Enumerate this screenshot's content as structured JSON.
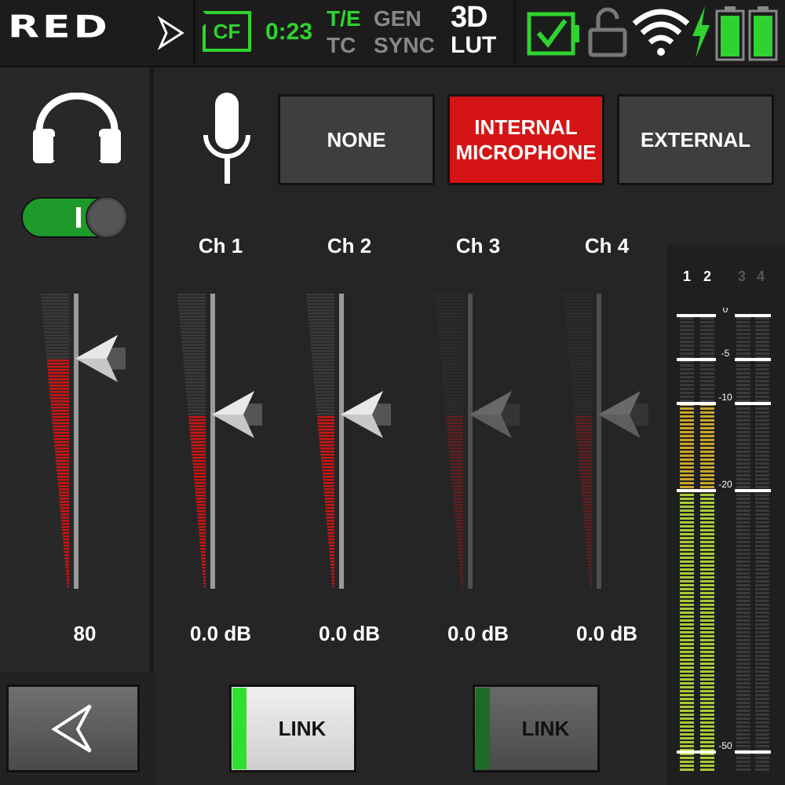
{
  "topbar": {
    "logo": "RED",
    "media": "CF",
    "timecode": "0:23",
    "te": "T/E",
    "tc": "TC",
    "gen": "GEN",
    "sync": "SYNC",
    "lut_line1": "3D",
    "lut_line2": "LUT",
    "icons": [
      "play-arrow-icon",
      "media-card-icon",
      "checkbox-icon",
      "lock-open-icon",
      "wifi-icon",
      "lightning-icon",
      "battery-icon",
      "battery-icon"
    ],
    "colors": {
      "accent": "#2fd32f",
      "inactive": "#888888"
    }
  },
  "headphones": {
    "icon": "headphones-icon",
    "toggle_on": true,
    "level_value": "80",
    "level_fraction": 0.78
  },
  "input_source": {
    "icon": "microphone-icon",
    "options": [
      "NONE",
      "INTERNAL\nMICROPHONE",
      "EXTERNAL"
    ],
    "labels": {
      "none": "NONE",
      "internal_l1": "INTERNAL",
      "internal_l2": "MICROPHONE",
      "external": "EXTERNAL"
    },
    "selected": "INTERNAL MICROPHONE",
    "selected_color": "#d51515"
  },
  "channels": [
    {
      "label": "Ch 1",
      "gain": "0.0 dB",
      "active": true,
      "level_fraction": 0.59
    },
    {
      "label": "Ch 2",
      "gain": "0.0 dB",
      "active": true,
      "level_fraction": 0.59
    },
    {
      "label": "Ch 3",
      "gain": "0.0 dB",
      "active": false,
      "level_fraction": 0.59
    },
    {
      "label": "Ch 4",
      "gain": "0.0 dB",
      "active": false,
      "level_fraction": 0.59
    }
  ],
  "links": [
    {
      "label": "LINK",
      "enabled": true
    },
    {
      "label": "LINK",
      "enabled": false
    }
  ],
  "meter": {
    "channels": [
      "1",
      "2",
      "3",
      "4"
    ],
    "scale": [
      "0",
      "-5",
      "-10",
      "-20",
      "-50"
    ],
    "level_db": -10
  },
  "back_button": {
    "icon": "back-arrow-icon"
  }
}
